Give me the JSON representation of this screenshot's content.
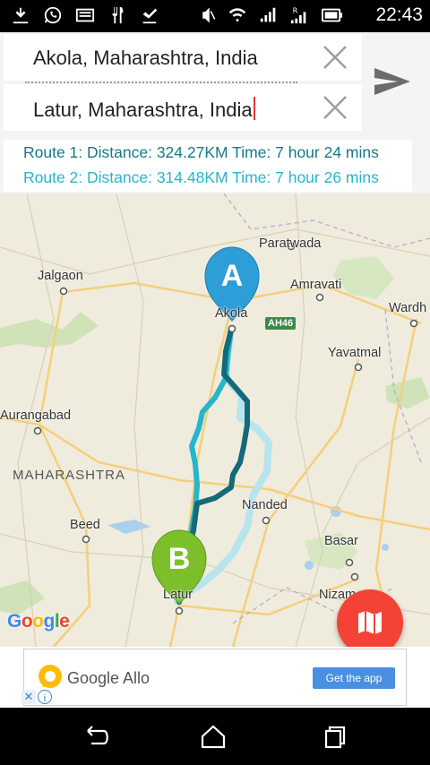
{
  "status_bar": {
    "time": "22:43",
    "left_icons": [
      "usb-debug-icon",
      "whatsapp-icon",
      "keyboard-icon",
      "restaurant-icon",
      "download-done-icon"
    ],
    "right_icons": [
      "mute-icon",
      "wifi-icon",
      "signal-icon",
      "roaming-signal-icon",
      "battery-icon"
    ]
  },
  "search": {
    "origin": "Akola, Maharashtra, India",
    "destination": "Latur, Maharashtra, India"
  },
  "routes": [
    {
      "label": "Route 1: Distance: 324.27KM  Time: 7 hour 24 mins",
      "color": "#147a88"
    },
    {
      "label": "Route 2: Distance: 314.48KM  Time: 7 hour 26 mins",
      "color": "#26b6cc"
    }
  ],
  "map": {
    "places": {
      "paratwada": "Paratwada",
      "jalgaon": "Jalgaon",
      "amravati": "Amravati",
      "wardha": "Wardh",
      "akola": "Akola",
      "yavatmal": "Yavatmal",
      "aurangabad": "Aurangabad",
      "nanded": "Nanded",
      "beed": "Beed",
      "basar": "Basar",
      "latur": "Latur",
      "nizamabad": "Nizam"
    },
    "state_label": "MAHARASHTRA",
    "highway": "AH46",
    "marker_a": "A",
    "marker_b": "B",
    "logo": [
      "G",
      "o",
      "o",
      "g",
      "l",
      "e"
    ],
    "logo_colors": [
      "#4285f4",
      "#ea4335",
      "#fbbc05",
      "#4285f4",
      "#34a853",
      "#ea4335"
    ]
  },
  "ad": {
    "name": "Google Allo",
    "cta": "Get the app",
    "close": "✕",
    "info": "i"
  },
  "colors": {
    "accent_red": "#f44336",
    "route1": "#147a88",
    "route2": "#26b6cc",
    "marker_a": "#2e9ed8",
    "marker_b": "#7cbf2b"
  }
}
